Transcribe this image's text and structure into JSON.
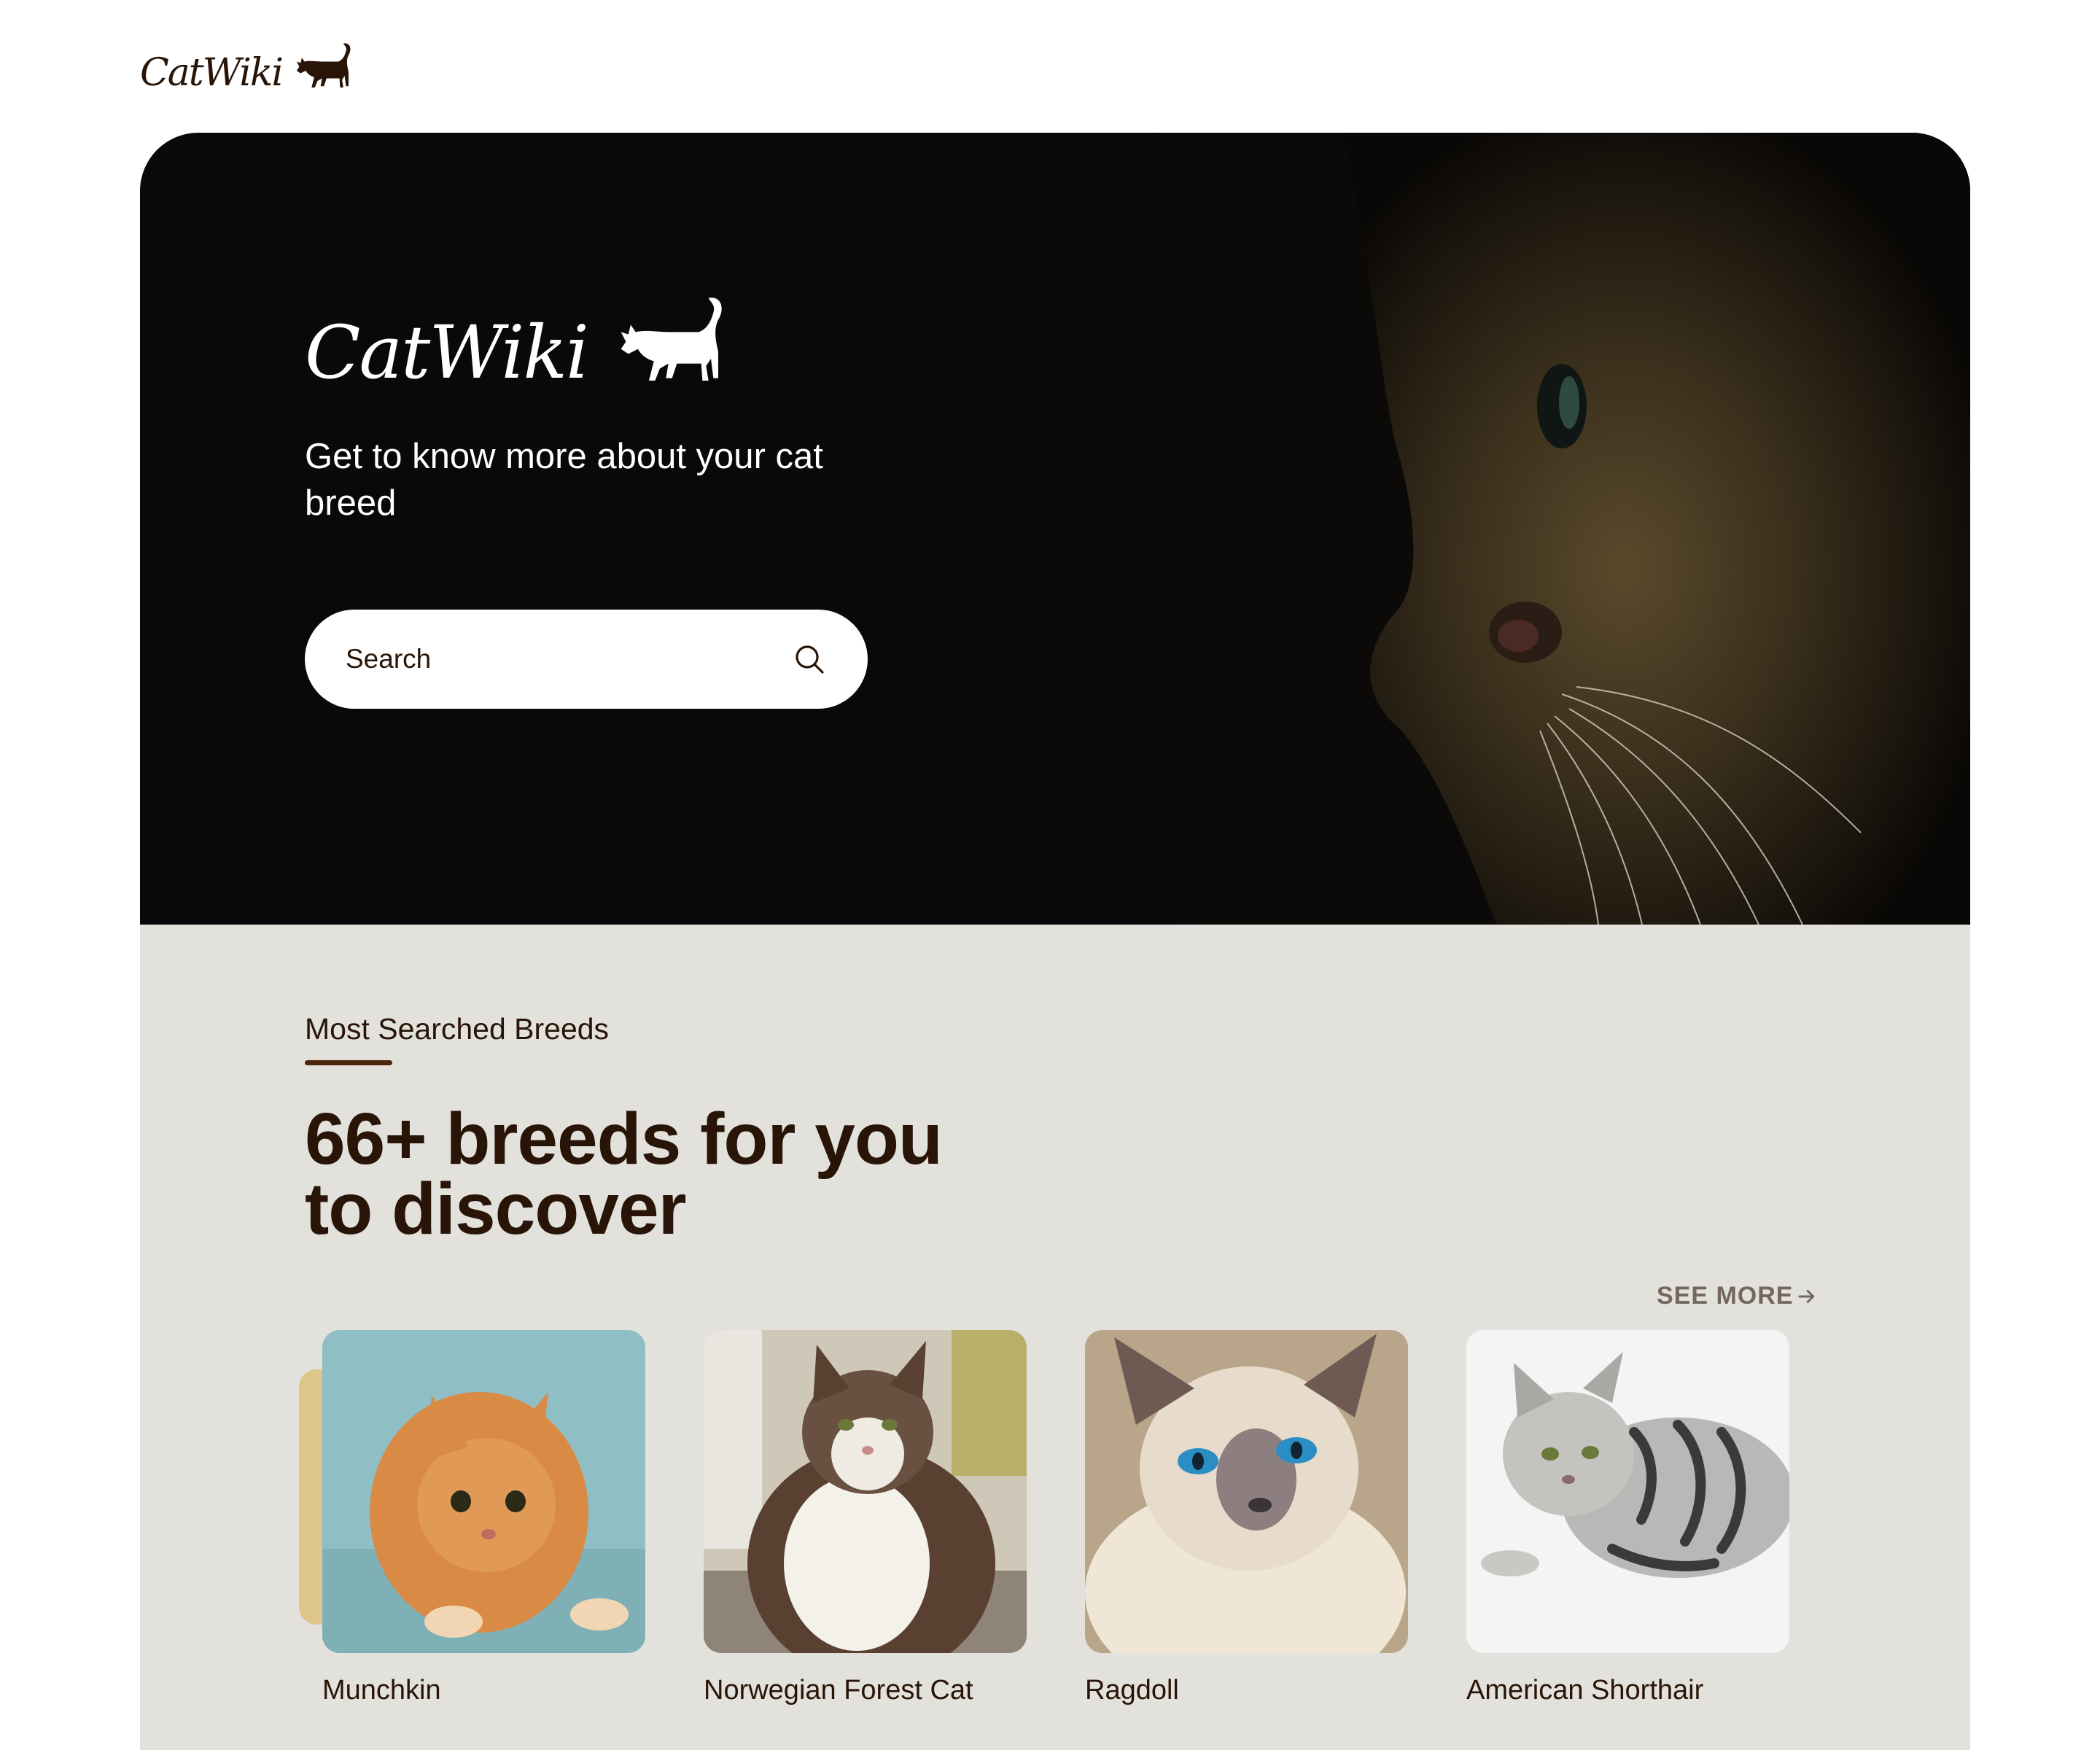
{
  "header": {
    "logo_text": "CatWiki"
  },
  "hero": {
    "logo_text": "CatWiki",
    "tagline": "Get to know more about your cat breed",
    "search_placeholder": "Search"
  },
  "breeds_section": {
    "label": "Most Searched Breeds",
    "headline_line1": "66+ breeds for you",
    "headline_line2": "to discover",
    "see_more": "SEE MORE",
    "breeds": [
      {
        "name": "Munchkin"
      },
      {
        "name": "Norwegian Forest Cat"
      },
      {
        "name": "Ragdoll"
      },
      {
        "name": "American Shorthair"
      }
    ]
  },
  "colors": {
    "brand_dark": "#291507",
    "hero_bg": "#08090b",
    "section_bg": "#e3e1dc",
    "accent": "#dec68b"
  },
  "icons": [
    "cat-silhouette-icon",
    "search-icon",
    "arrow-right-icon"
  ]
}
